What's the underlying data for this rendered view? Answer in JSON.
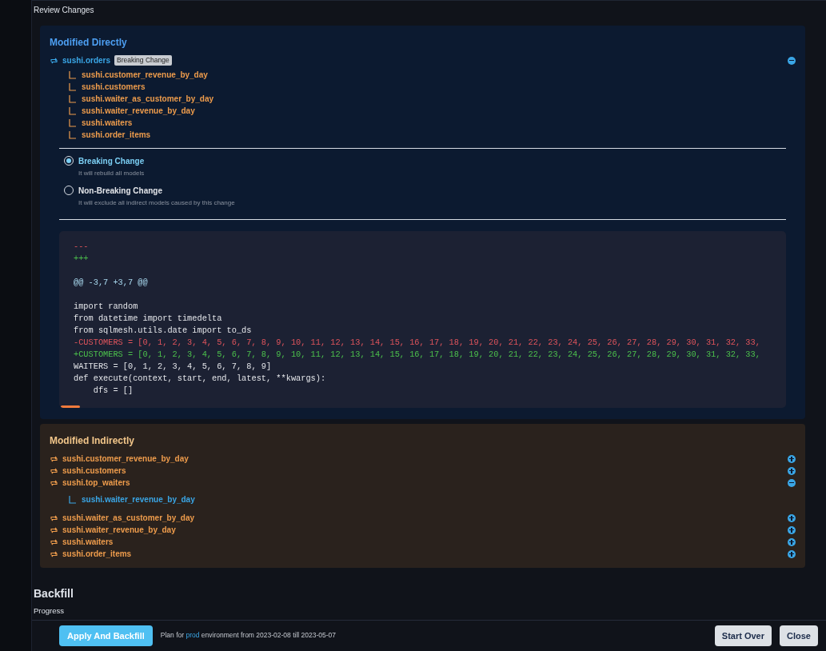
{
  "section_title": "Review Changes",
  "modified_directly": {
    "title": "Modified Directly",
    "models": [
      {
        "name": "sushi.orders",
        "badge": "Breaking Change",
        "expanded": true,
        "children": [
          "sushi.customer_revenue_by_day",
          "sushi.customers",
          "sushi.waiter_as_customer_by_day",
          "sushi.waiter_revenue_by_day",
          "sushi.waiters",
          "sushi.order_items"
        ]
      }
    ],
    "options": [
      {
        "label": "Breaking Change",
        "description": "It will rebuild all models",
        "selected": true
      },
      {
        "label": "Non-Breaking Change",
        "description": "It will exclude all indirect models caused by this change",
        "selected": false
      }
    ],
    "diff": [
      {
        "kind": "removed",
        "text": "---"
      },
      {
        "kind": "added",
        "text": "+++"
      },
      {
        "kind": "blank"
      },
      {
        "kind": "hunk",
        "text": "@@ -3,7 +3,7 @@"
      },
      {
        "kind": "blank"
      },
      {
        "kind": "context",
        "text": "import random"
      },
      {
        "kind": "context",
        "text": "from datetime import timedelta"
      },
      {
        "kind": "context",
        "text": "from sqlmesh.utils.date import to_ds"
      },
      {
        "kind": "removed",
        "text": "-CUSTOMERS = [0, 1, 2, 3, 4, 5, 6, 7, 8, 9, 10, 11, 12, 13, 14, 15, 16, 17, 18, 19, 20, 21, 22, 23, 24, 25, 26, 27, 28, 29, 30, 31, 32, 33,"
      },
      {
        "kind": "added",
        "text": "+CUSTOMERS = [0, 1, 2, 3, 4, 5, 6, 7, 8, 9, 10, 11, 12, 13, 14, 15, 16, 17, 18, 19, 20, 21, 22, 23, 24, 25, 26, 27, 28, 29, 30, 31, 32, 33,"
      },
      {
        "kind": "context",
        "text": "WAITERS = [0, 1, 2, 3, 4, 5, 6, 7, 8, 9]"
      },
      {
        "kind": "context",
        "text": "def execute(context, start, end, latest, **kwargs):"
      },
      {
        "kind": "context",
        "text": "    dfs = []"
      }
    ]
  },
  "modified_indirectly": {
    "title": "Modified Indirectly",
    "models": [
      {
        "name": "sushi.customer_revenue_by_day",
        "expanded": false
      },
      {
        "name": "sushi.customers",
        "expanded": false
      },
      {
        "name": "sushi.top_waiters",
        "expanded": true,
        "children": [
          "sushi.waiter_revenue_by_day"
        ]
      },
      {
        "name": "sushi.waiter_as_customer_by_day",
        "expanded": false
      },
      {
        "name": "sushi.waiter_revenue_by_day",
        "expanded": false
      },
      {
        "name": "sushi.waiters",
        "expanded": false
      },
      {
        "name": "sushi.order_items",
        "expanded": false
      }
    ]
  },
  "backfill": {
    "title": "Backfill",
    "progress_label": "Progress"
  },
  "footer": {
    "primary_button": "Apply And Backfill",
    "plan_prefix": "Plan for",
    "environment": "prod",
    "plan_suffix": "environment from 2023-02-08 till 2023-05-07",
    "buttons": [
      "Start Over",
      "Close"
    ]
  }
}
